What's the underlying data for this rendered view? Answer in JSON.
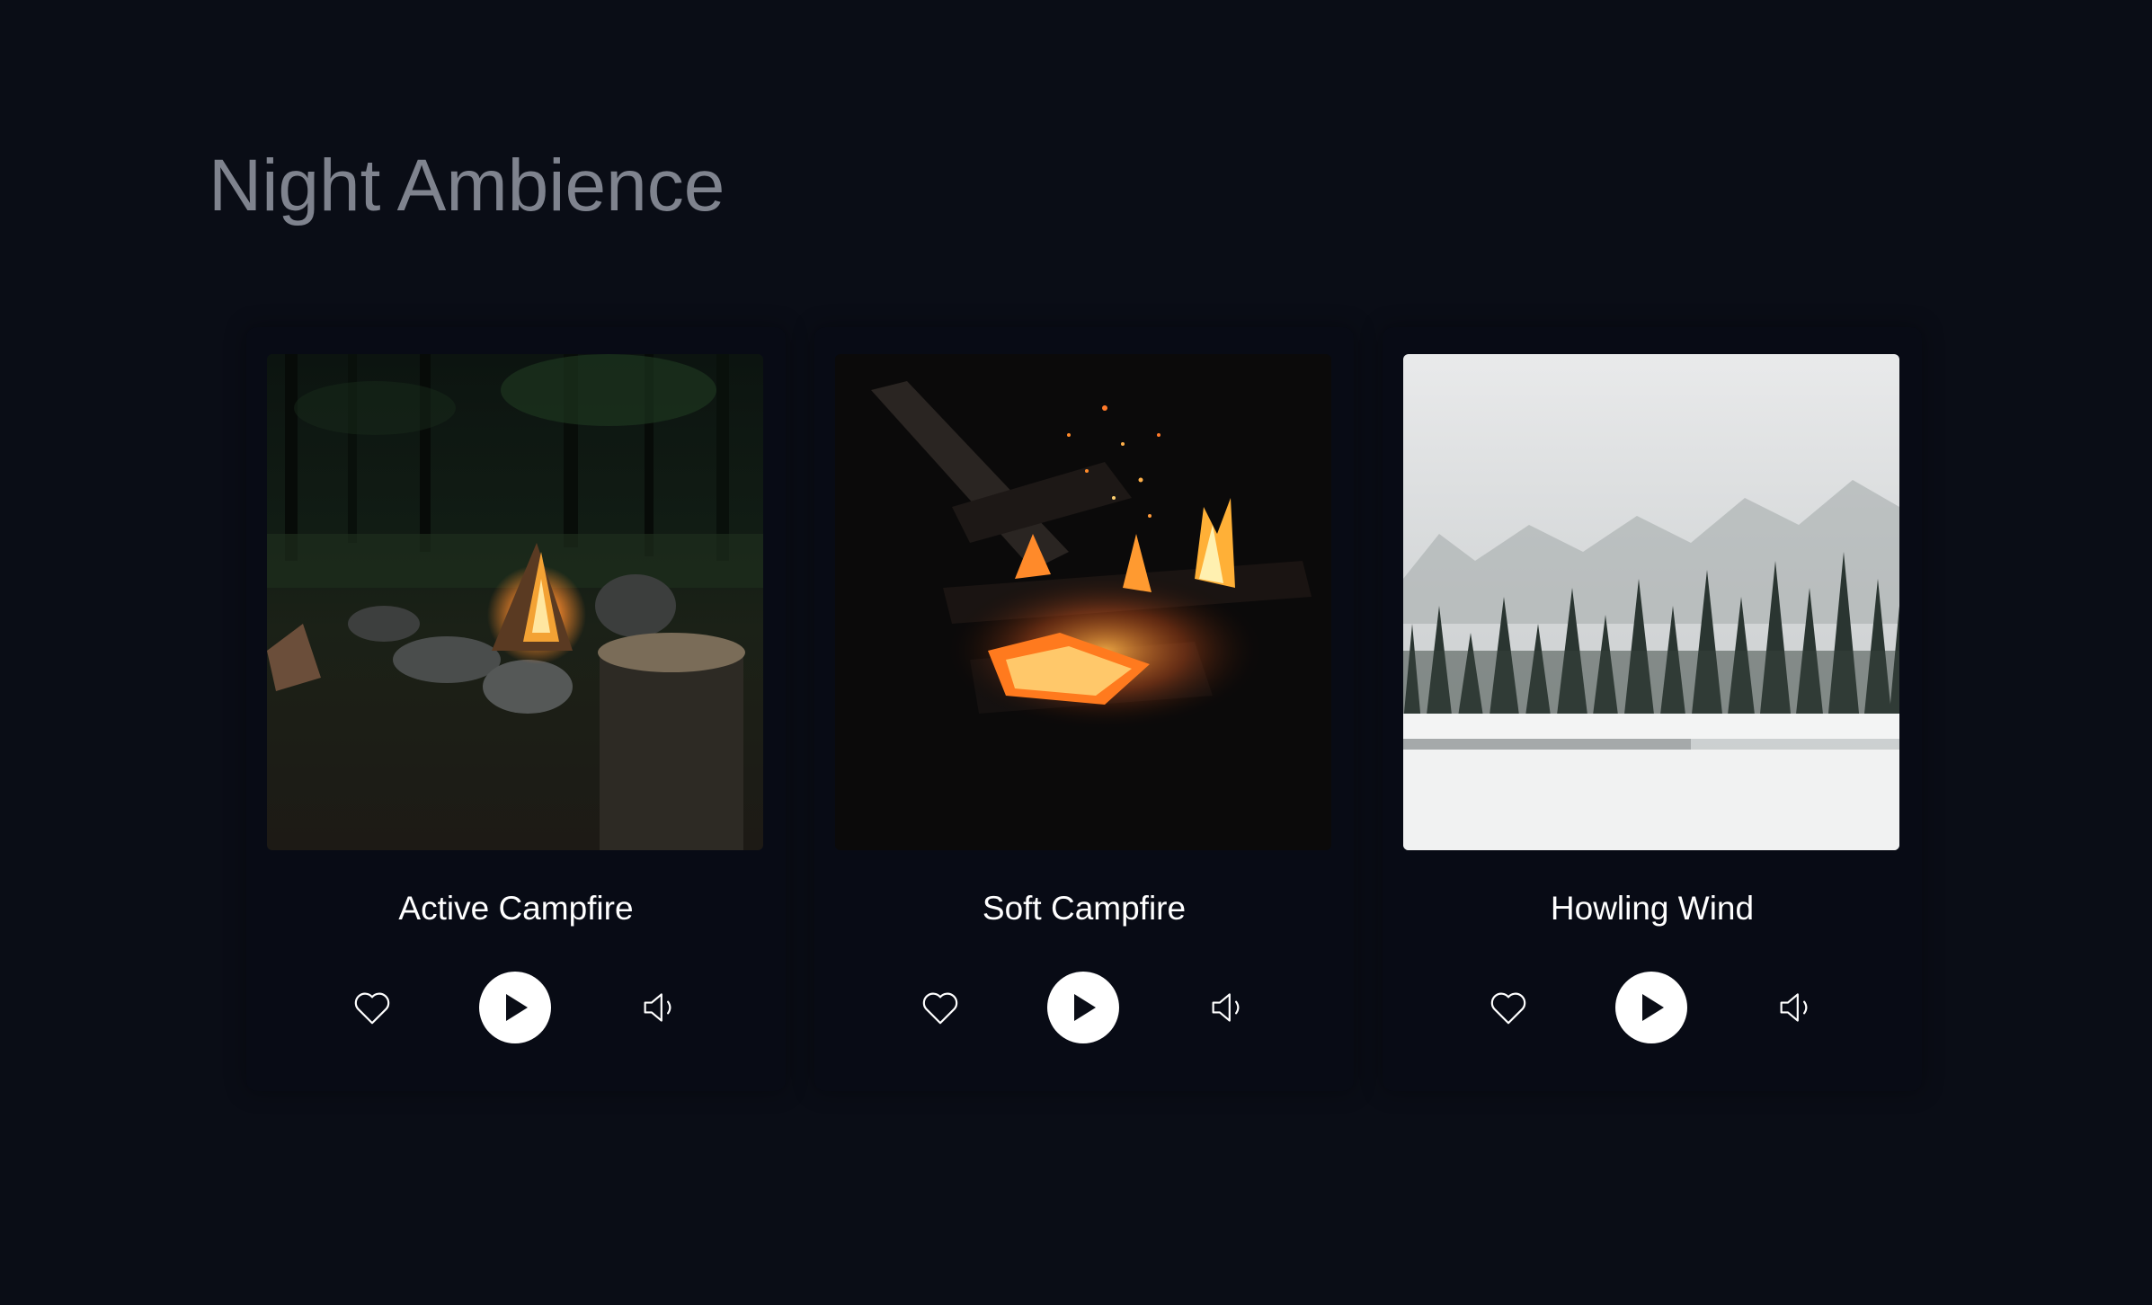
{
  "page": {
    "title": "Night Ambience"
  },
  "colors": {
    "background": "#0a0d16",
    "card": "#080b15",
    "title": "#7f838e",
    "text": "#ffffff",
    "play_button": "#ffffff"
  },
  "cards": [
    {
      "title": "Active Campfire",
      "image_subject": "campfire in dark forest",
      "icons": [
        "heart-icon",
        "play-icon",
        "volume-icon"
      ]
    },
    {
      "title": "Soft Campfire",
      "image_subject": "glowing embers and flames at night",
      "icons": [
        "heart-icon",
        "play-icon",
        "volume-icon"
      ]
    },
    {
      "title": "Howling Wind",
      "image_subject": "snowy pine forest by frozen lake",
      "icons": [
        "heart-icon",
        "play-icon",
        "volume-icon"
      ]
    }
  ]
}
